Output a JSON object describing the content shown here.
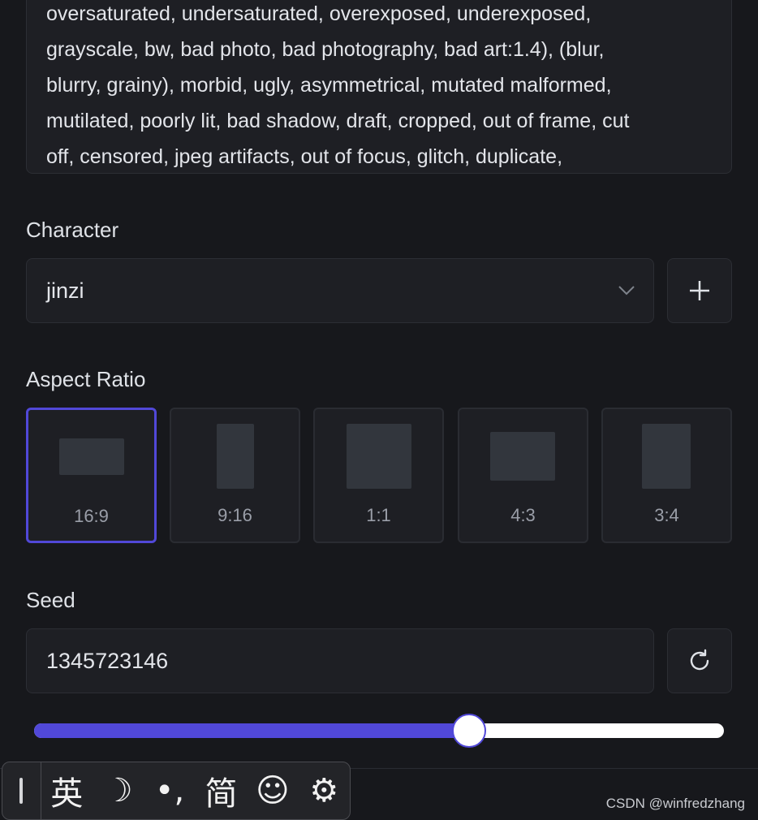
{
  "negative_prompt": {
    "text": "oversaturated, undersaturated, overexposed, underexposed,\ngrayscale, bw, bad photo, bad photography, bad art:1.4), (blur,\nblurry, grainy), morbid, ugly, asymmetrical, mutated malformed,\nmutilated, poorly lit, bad shadow, draft, cropped, out of frame, cut\noff, censored, jpeg artifacts, out of focus, glitch, duplicate,"
  },
  "character": {
    "label": "Character",
    "selected": "jinzi",
    "add_icon": "plus-icon",
    "dropdown_icon": "chevron-down-icon"
  },
  "aspect_ratio": {
    "label": "Aspect Ratio",
    "selected": "16:9",
    "options": [
      {
        "label": "16:9"
      },
      {
        "label": "9:16"
      },
      {
        "label": "1:1"
      },
      {
        "label": "4:3"
      },
      {
        "label": "3:4"
      }
    ]
  },
  "seed": {
    "label": "Seed",
    "value": "1345723146",
    "refresh_icon": "refresh-icon",
    "slider_fraction": 0.63
  },
  "ime_toolbar": {
    "items": [
      {
        "label": "英",
        "name": "ime-english-toggle"
      },
      {
        "label": "☽",
        "name": "moon-icon"
      },
      {
        "label": "•,",
        "name": "punctuation-icon"
      },
      {
        "label": "简",
        "name": "ime-simplified-toggle"
      },
      {
        "label": "☺",
        "name": "emoji-icon"
      },
      {
        "label": "⚙",
        "name": "gear-icon"
      }
    ]
  },
  "watermark": "CSDN @winfredzhang",
  "colors": {
    "accent": "#5148d8",
    "background": "#17181c",
    "panel": "#1e1f24"
  }
}
